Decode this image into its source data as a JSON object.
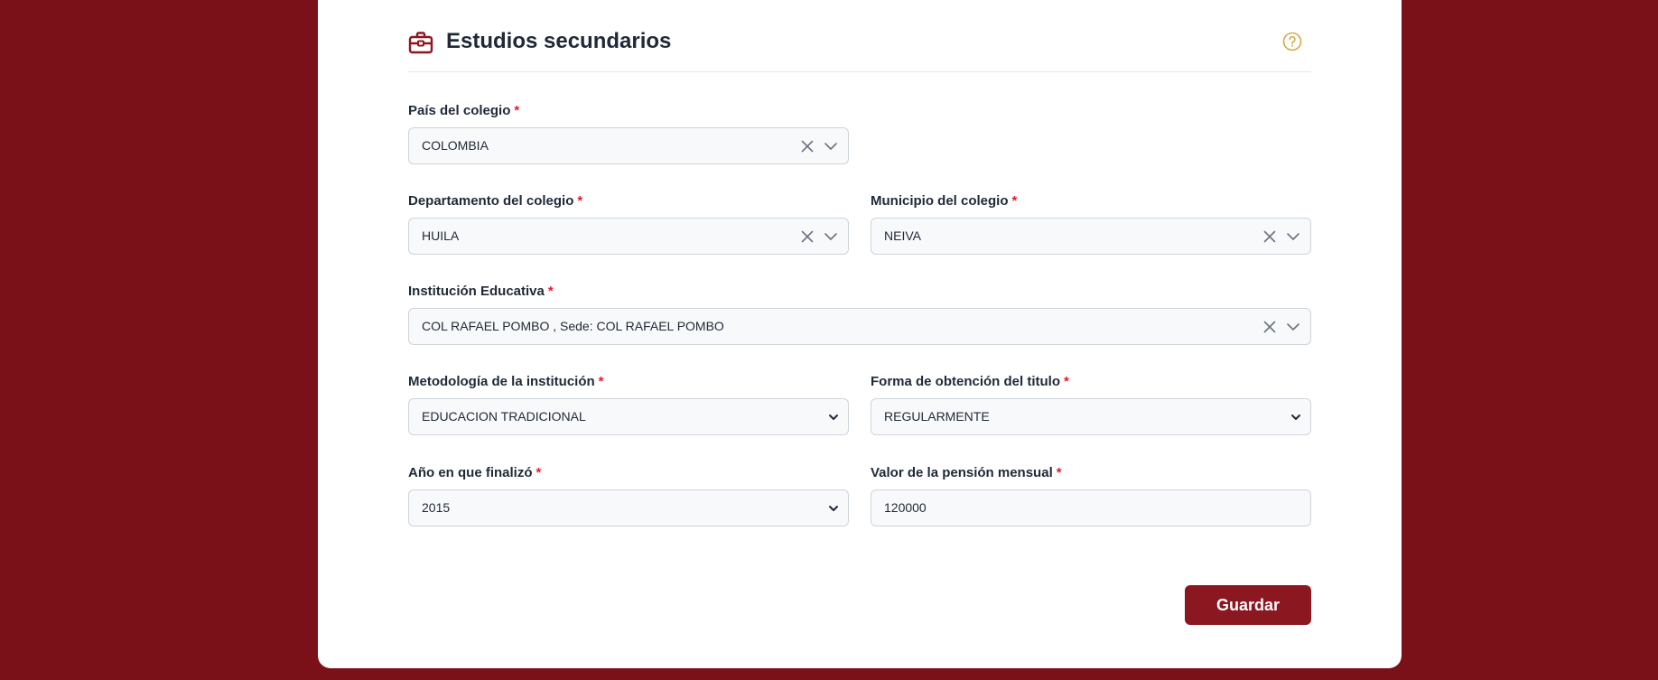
{
  "section": {
    "title": "Estudios secundarios"
  },
  "fields": {
    "pais": {
      "label": "País del colegio",
      "required_mark": "*",
      "value": "COLOMBIA"
    },
    "departamento": {
      "label": "Departamento del colegio",
      "required_mark": "*",
      "value": "HUILA"
    },
    "municipio": {
      "label": "Municipio del colegio",
      "required_mark": "*",
      "value": "NEIVA"
    },
    "institucion": {
      "label": "Institución Educativa",
      "required_mark": "*",
      "value": "COL RAFAEL POMBO , Sede: COL RAFAEL POMBO"
    },
    "metodologia": {
      "label": "Metodología de la institución",
      "required_mark": "*",
      "value": "EDUCACION TRADICIONAL"
    },
    "forma": {
      "label": "Forma de obtención del titulo",
      "required_mark": "*",
      "value": "REGULARMENTE"
    },
    "anio": {
      "label": "Año en que finalizó",
      "required_mark": "*",
      "value": "2015"
    },
    "pension": {
      "label": "Valor de la pensión mensual",
      "required_mark": "*",
      "value": "120000"
    }
  },
  "actions": {
    "save_label": "Guardar"
  },
  "icons": {
    "title": "briefcase-icon",
    "help": "help-circle-icon",
    "clear": "close-icon",
    "dropdown": "chevron-down-icon"
  },
  "colors": {
    "background": "#7a1118",
    "accent": "#8b1720",
    "required": "#e11d2a",
    "help_icon": "#d4a94a"
  }
}
